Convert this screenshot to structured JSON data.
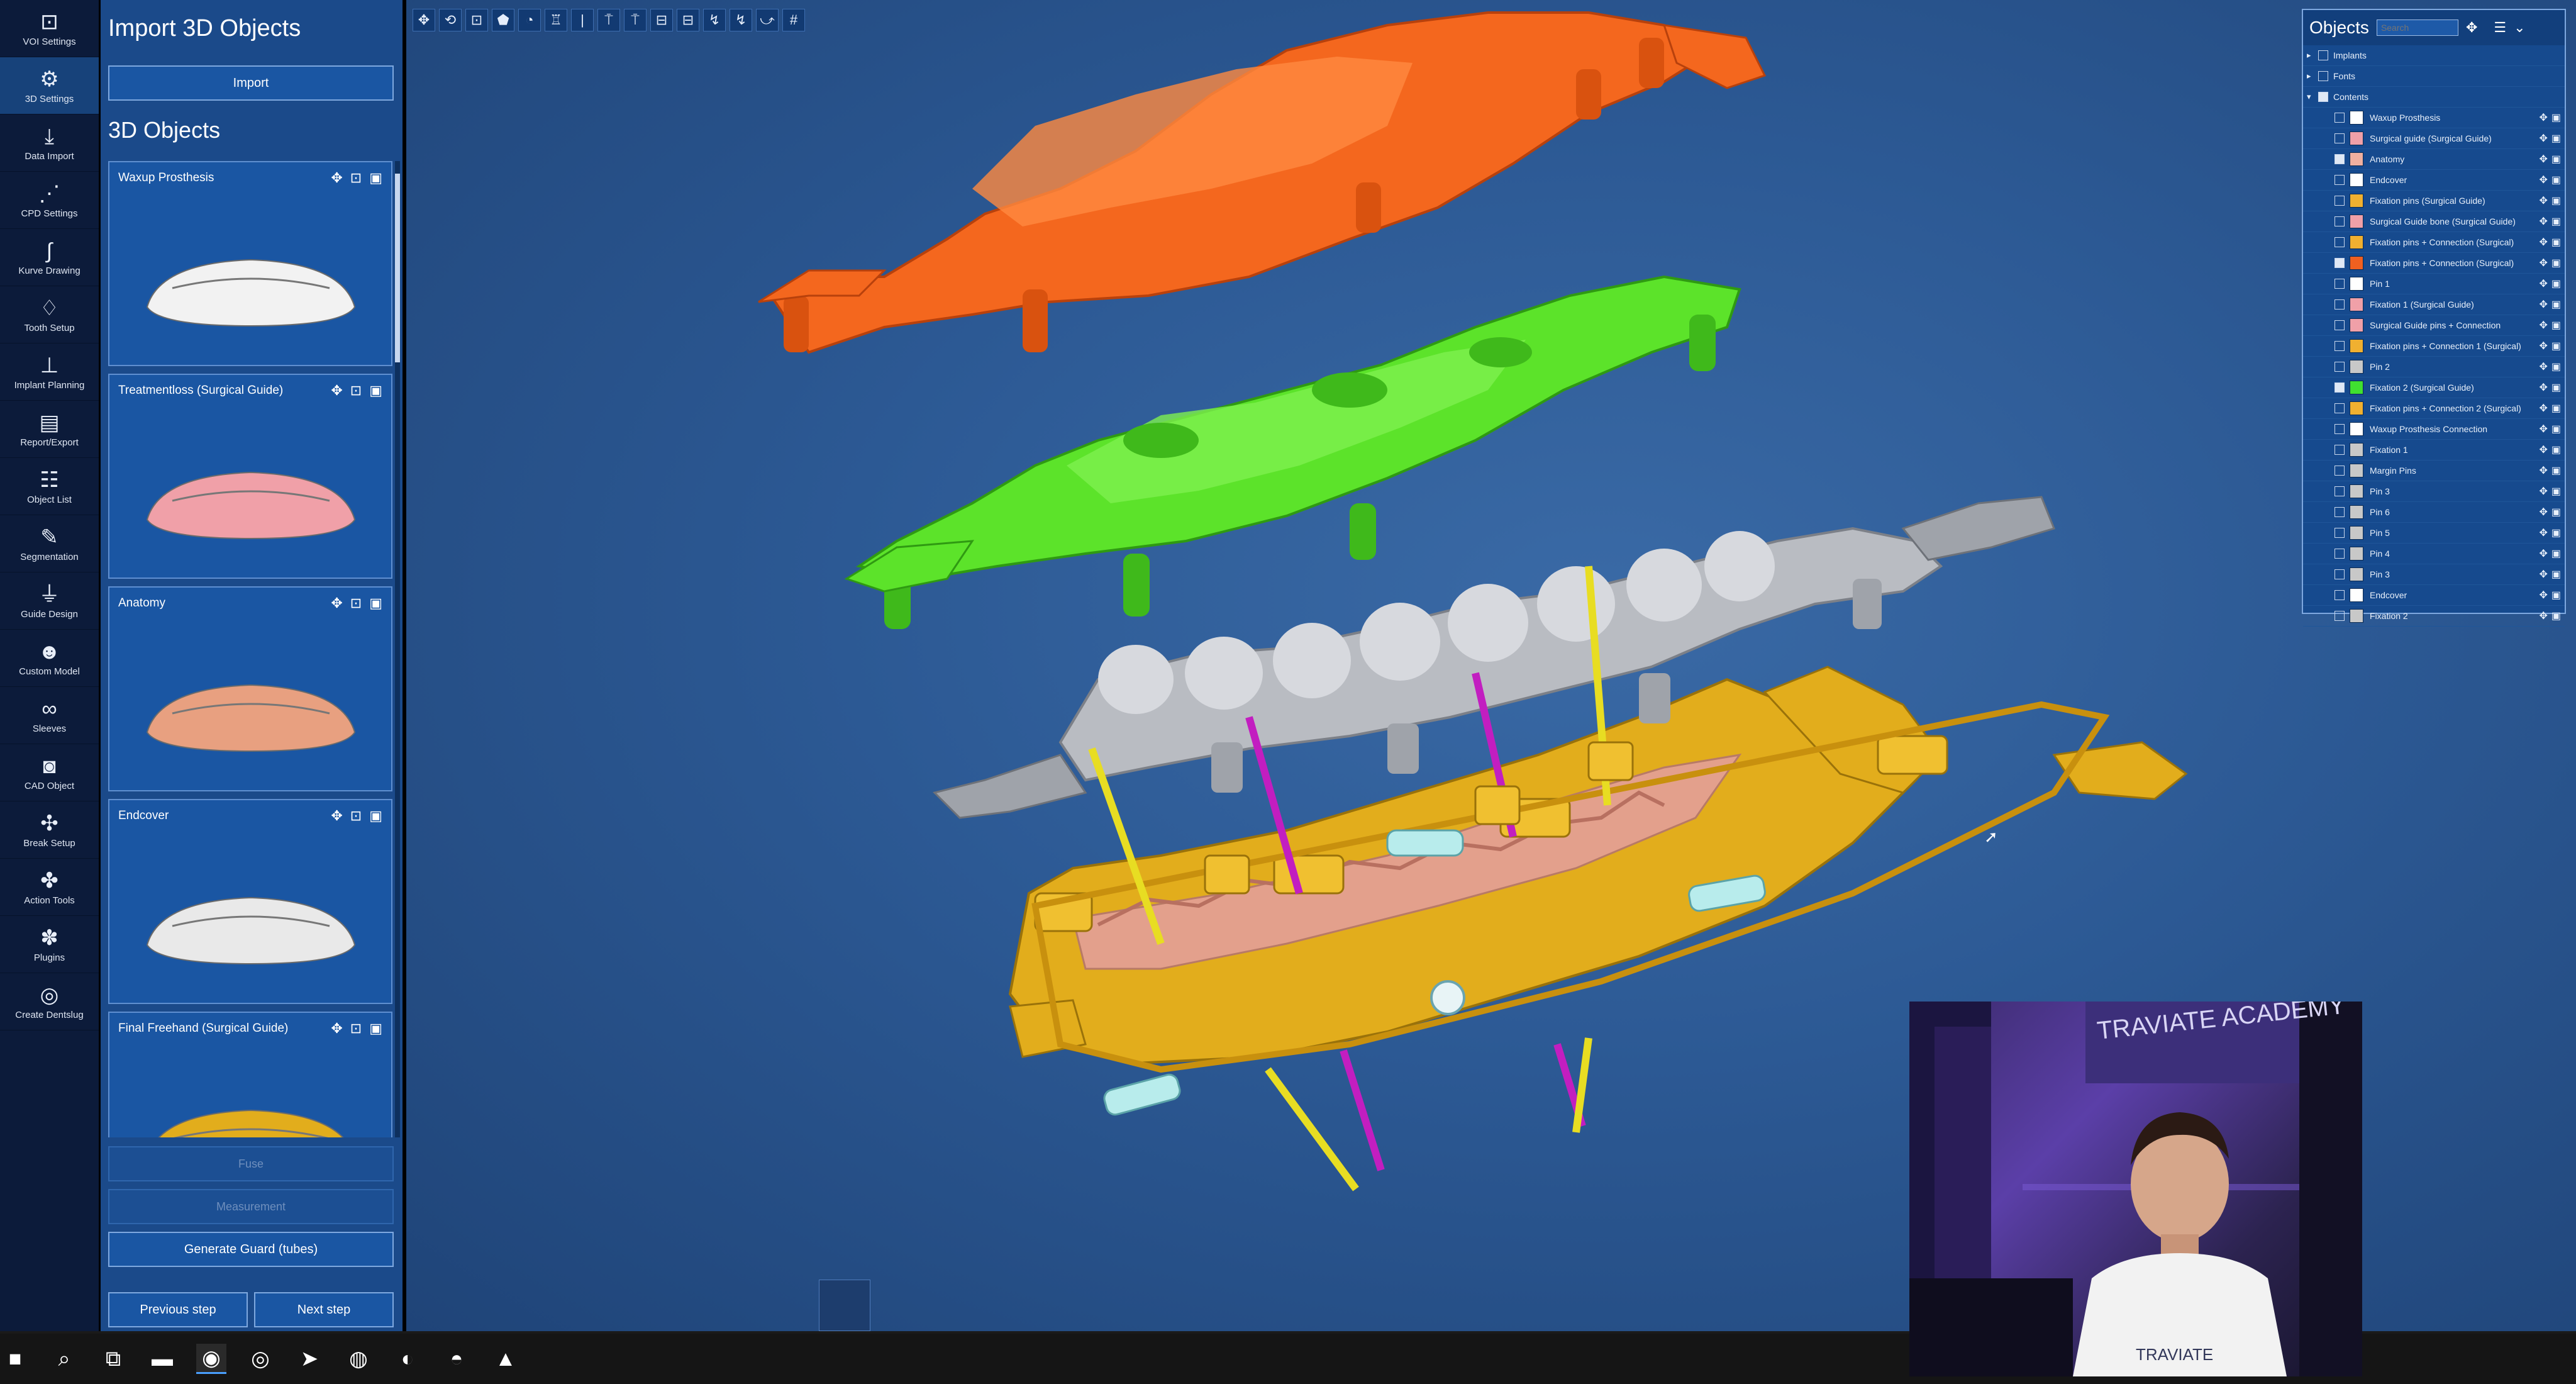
{
  "rail": {
    "items": [
      {
        "label": "VOI Settings",
        "icon": "voi-icon"
      },
      {
        "label": "3D Settings",
        "icon": "settings-3d-icon"
      },
      {
        "label": "Data Import",
        "icon": "download-icon"
      },
      {
        "label": "CPD Settings",
        "icon": "dotted-arc-icon"
      },
      {
        "label": "Kurve Drawing",
        "icon": "curve-drawing-icon"
      },
      {
        "label": "Tooth Setup",
        "icon": "tooth-icon"
      },
      {
        "label": "Implant Planning",
        "icon": "implant-icon"
      },
      {
        "label": "Report/Export",
        "icon": "report-icon"
      },
      {
        "label": "Object List",
        "icon": "list-icon"
      },
      {
        "label": "Segmentation",
        "icon": "magic-wand-icon"
      },
      {
        "label": "Guide Design",
        "icon": "guide-icon"
      },
      {
        "label": "Custom Model",
        "icon": "model-icon"
      },
      {
        "label": "Sleeves",
        "icon": "sleeves-icon"
      },
      {
        "label": "CAD Object",
        "icon": "cad-object-icon"
      },
      {
        "label": "Break Setup",
        "icon": "break-icon"
      },
      {
        "label": "Action Tools",
        "icon": "action-icon"
      },
      {
        "label": "Plugins",
        "icon": "plugin-icon"
      },
      {
        "label": "Create Dentslug",
        "icon": "create-icon"
      }
    ]
  },
  "panel": {
    "title": "Import 3D Objects",
    "import_label": "Import",
    "objects_title": "3D Objects",
    "cards": [
      {
        "title": "Waxup Prosthesis",
        "color": "#f2f2f2"
      },
      {
        "title": "Treatmentloss (Surgical Guide)",
        "color": "#f0a0a8"
      },
      {
        "title": "Anatomy",
        "color": "#e8a080"
      },
      {
        "title": "Endcover",
        "color": "#e9e9e9"
      },
      {
        "title": "Final Freehand (Surgical Guide)",
        "color": "#e2ad1c"
      }
    ],
    "faint_button_1": "Fuse",
    "faint_button_2": "Measurement",
    "generate_label": "Generate Guard (tubes)",
    "prev_label": "Previous step",
    "next_label": "Next step"
  },
  "toolbar": {
    "tools": [
      "✥",
      "⟲",
      "⊡",
      "⬟",
      "◔",
      "♖",
      "|",
      "⍑",
      "⍑",
      "⊟",
      "⊟",
      "↯",
      "↯",
      "⤻",
      "#"
    ]
  },
  "objects_panel": {
    "title": "Objects",
    "search_placeholder": "Search",
    "groups": [
      {
        "label": "Implants",
        "arrow": "▸",
        "checked": false
      },
      {
        "label": "Fonts",
        "arrow": "▸",
        "checked": false
      },
      {
        "label": "Contents",
        "arrow": "▾",
        "checked": true
      }
    ],
    "rows": [
      {
        "name": "Waxup Prosthesis",
        "color": "#ffffff",
        "checked": false
      },
      {
        "name": "Surgical guide (Surgical Guide)",
        "color": "#f0a0a8",
        "checked": false
      },
      {
        "name": "Anatomy",
        "color": "#f0b0a0",
        "checked": true
      },
      {
        "name": "Endcover",
        "color": "#ffffff",
        "checked": false
      },
      {
        "name": "Fixation pins (Surgical Guide)",
        "color": "#f0b030",
        "checked": false
      },
      {
        "name": "Surgical Guide bone (Surgical Guide)",
        "color": "#f0a0a8",
        "checked": false
      },
      {
        "name": "Fixation pins + Connection (Surgical)",
        "color": "#f0b030",
        "checked": false
      },
      {
        "name": "Fixation pins + Connection (Surgical)",
        "color": "#f06020",
        "checked": true
      },
      {
        "name": "Pin 1",
        "color": "#ffffff",
        "checked": false
      },
      {
        "name": "Fixation 1 (Surgical Guide)",
        "color": "#f0a0a8",
        "checked": false
      },
      {
        "name": "Surgical Guide pins + Connection",
        "color": "#f0a0a8",
        "checked": false
      },
      {
        "name": "Fixation pins + Connection 1 (Surgical)",
        "color": "#f0b030",
        "checked": false
      },
      {
        "name": "Pin 2",
        "color": "#c8c8c8",
        "checked": false
      },
      {
        "name": "Fixation 2 (Surgical Guide)",
        "color": "#40e030",
        "checked": true
      },
      {
        "name": "Fixation pins + Connection 2 (Surgical)",
        "color": "#f0b030",
        "checked": false
      },
      {
        "name": "Waxup Prosthesis Connection",
        "color": "#ffffff",
        "checked": false
      },
      {
        "name": "Fixation 1",
        "color": "#c8c8c8",
        "checked": false
      },
      {
        "name": "Margin Pins",
        "color": "#c8c8c8",
        "checked": false
      },
      {
        "name": "Pin 3",
        "color": "#c8c8c8",
        "checked": false
      },
      {
        "name": "Pin 6",
        "color": "#c8c8c8",
        "checked": false
      },
      {
        "name": "Pin 5",
        "color": "#c8c8c8",
        "checked": false
      },
      {
        "name": "Pin 4",
        "color": "#c8c8c8",
        "checked": false
      },
      {
        "name": "Pin 3",
        "color": "#c8c8c8",
        "checked": false
      },
      {
        "name": "Endcover",
        "color": "#ffffff",
        "checked": false
      },
      {
        "name": "Fixation 2",
        "color": "#c8c8c8",
        "checked": false
      }
    ]
  },
  "webcam": {
    "sign_text": "TRAVIATE ACADEMY",
    "shirt_text": "TRAVIATE"
  },
  "taskbar": {
    "items": [
      {
        "icon": "windows-icon",
        "glyph": "■"
      },
      {
        "icon": "search-icon",
        "glyph": "⌕"
      },
      {
        "icon": "task-view-icon",
        "glyph": "⧉"
      },
      {
        "icon": "folder-icon",
        "glyph": "▬"
      },
      {
        "icon": "app-blue-icon",
        "glyph": "◉"
      },
      {
        "icon": "app-circle-icon",
        "glyph": "◎"
      },
      {
        "icon": "telegram-icon",
        "glyph": "➤"
      },
      {
        "icon": "chrome-icon",
        "glyph": "◍"
      },
      {
        "icon": "app-orange-icon",
        "glyph": "◐"
      },
      {
        "icon": "app-red-icon",
        "glyph": "◓"
      },
      {
        "icon": "app-drop-icon",
        "glyph": "▲"
      }
    ]
  },
  "colors": {
    "guide_orange": "#f4671e",
    "guide_green": "#5ce32a",
    "prosthesis_gray": "#b9bcc2",
    "base_gold": "#e2ad1c",
    "gum_pink": "#e3a08c",
    "pin_yellow": "#e8dd22",
    "pin_magenta": "#c21ec0"
  }
}
